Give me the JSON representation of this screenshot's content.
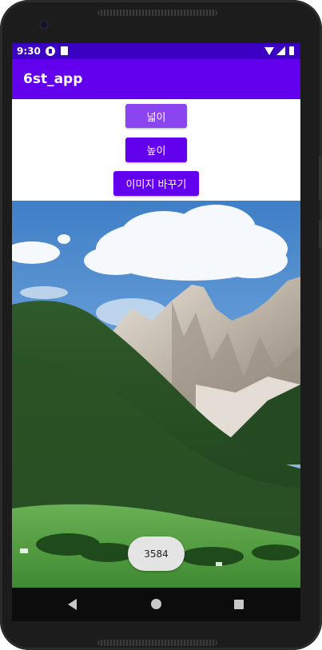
{
  "status_bar": {
    "time": "9:30",
    "icons": [
      "notification-icon",
      "sim-icon",
      "wifi-icon",
      "signal-icon",
      "battery-icon"
    ]
  },
  "app_bar": {
    "title": "6st_app"
  },
  "buttons": {
    "width_label": "넓이",
    "height_label": "높이",
    "change_image_label": "이미지 바꾸기"
  },
  "image": {
    "content": "mountain landscape photo"
  },
  "toast": {
    "text": "3584"
  },
  "nav_bar": {
    "icons": [
      "back-icon",
      "home-icon",
      "recents-icon"
    ]
  },
  "colors": {
    "status_bar": "#3a00c4",
    "app_bar": "#6200ee",
    "button": "#6200ee",
    "button_pressed": "#8a44f0",
    "toast": "#e4e4e4",
    "nav_bar": "#0c0c0c"
  }
}
